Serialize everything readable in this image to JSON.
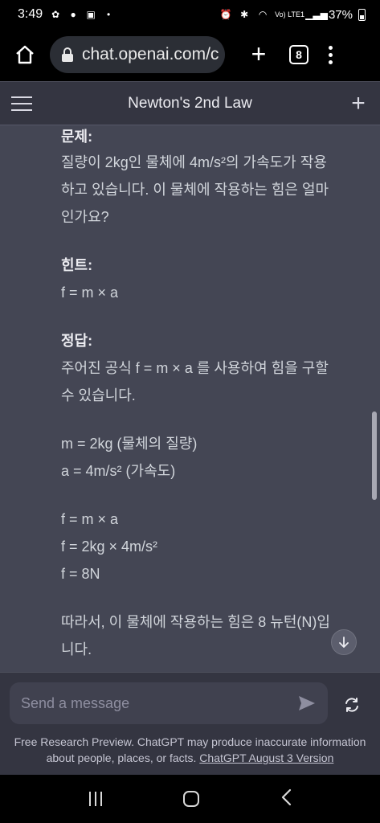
{
  "status": {
    "time": "3:49",
    "network": "Vo) LTE1",
    "battery": "37%"
  },
  "browser": {
    "url": "chat.openai.com/c",
    "tab_count": "8"
  },
  "chat": {
    "title": "Newton's 2nd Law"
  },
  "message": {
    "problem_heading": "문제:",
    "problem_line1": "질량이 2kg인 물체에 4m/s²의 가속도가 작용",
    "problem_line2": "하고 있습니다. 이 물체에 작용하는 힘은 얼마",
    "problem_line3": "인가요?",
    "hint_heading": "힌트:",
    "hint_formula": "f = m × a",
    "answer_heading": "정답:",
    "answer_line1": "주어진 공식 f = m × a 를 사용하여 힘을 구할",
    "answer_line2": "수 있습니다.",
    "given_mass": "m = 2kg (물체의 질량)",
    "given_accel": "a = 4m/s² (가속도)",
    "calc1": "f = m × a",
    "calc2": "f = 2kg × 4m/s²",
    "calc3": "f = 8N",
    "conclusion_line1": "따라서, 이 물체에 작용하는 힘은 8 뉴턴(N)입",
    "conclusion_line2": "니다."
  },
  "composer": {
    "placeholder": "Send a message"
  },
  "footer": {
    "disclaimer": "Free Research Preview. ChatGPT may produce inaccurate information about people, places, or facts.",
    "version_link": "ChatGPT August 3 Version"
  }
}
